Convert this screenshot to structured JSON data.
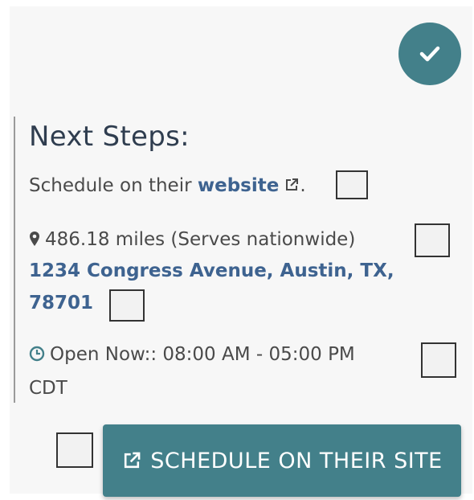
{
  "confirm": {
    "icon": "check-icon"
  },
  "next_steps": {
    "title": "Next Steps:",
    "schedule_prefix": "Schedule on their ",
    "schedule_link": "website",
    "schedule_suffix": ".",
    "distance_icon": "map-marker-icon",
    "distance": "486.18 miles (Serves nationwide)",
    "address_line1": "1234 Congress Avenue, Austin, TX,",
    "address_line2": "78701",
    "hours_icon": "clock-icon",
    "hours_line1": "Open Now:: 08:00 AM - 05:00 PM",
    "hours_line2": "CDT"
  },
  "cta": {
    "label": "SCHEDULE ON THEIR SITE",
    "icon": "external-link-icon"
  },
  "colors": {
    "accent": "#43808a",
    "link": "#3e6390",
    "heading": "#2f3d4f"
  }
}
